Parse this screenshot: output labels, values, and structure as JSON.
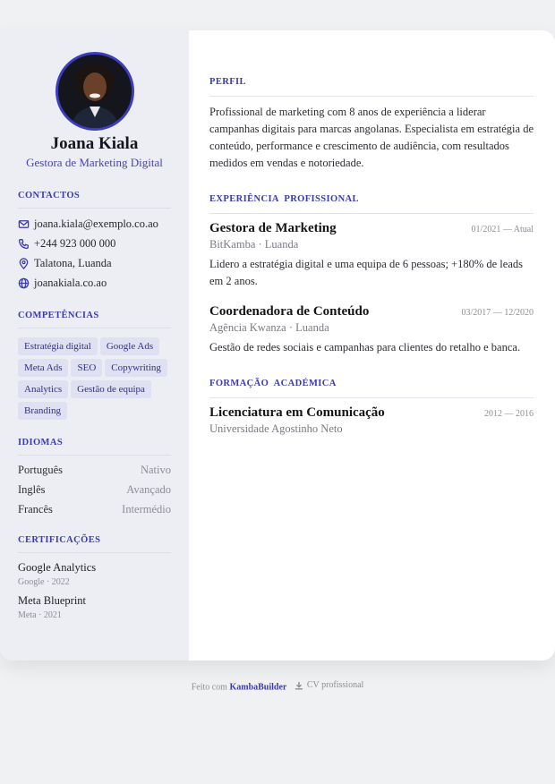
{
  "profile": {
    "name": "Joana Kiala",
    "role": "Gestora de Marketing Digital"
  },
  "contacts": {
    "title": "CONTACTOS",
    "email": "joana.kiala@exemplo.co.ao",
    "phone": "+244 923 000 000",
    "location": "Talatona, Luanda",
    "website": "joanakiala.co.ao"
  },
  "skills": {
    "title": "COMPETÊNCIAS",
    "items": [
      "Estratégia digital",
      "Google Ads",
      "Meta Ads",
      "SEO",
      "Copywriting",
      "Analytics",
      "Gestão de equipa",
      "Branding"
    ]
  },
  "languages": {
    "title": "IDIOMAS",
    "items": [
      {
        "name": "Português",
        "level": "Nativo"
      },
      {
        "name": "Inglês",
        "level": "Avançado"
      },
      {
        "name": "Francês",
        "level": "Intermédio"
      }
    ]
  },
  "certifications": {
    "title": "CERTIFICAÇÕES",
    "items": [
      {
        "name": "Google Analytics",
        "meta": "Google · 2022"
      },
      {
        "name": "Meta Blueprint",
        "meta": "Meta · 2021"
      }
    ]
  },
  "perfil": {
    "title": "PERFIL",
    "text": "Profissional de marketing com 8 anos de experiência a liderar campanhas digitais para marcas angolanas. Especialista em estratégia de conteúdo, performance e crescimento de audiência, com resultados medidos em vendas e notoriedade."
  },
  "experience": {
    "title": "EXPERIÊNCIA  PROFISSIONAL",
    "items": [
      {
        "title": "Gestora de Marketing",
        "date": "01/2021 — Atual",
        "company": "BitKamba · Luanda",
        "desc": "Lidero a estratégia digital e uma equipa de 6 pessoas; +180% de leads em 2 anos."
      },
      {
        "title": "Coordenadora de Conteúdo",
        "date": "03/2017 — 12/2020",
        "company": "Agência Kwanza · Luanda",
        "desc": "Gestão de redes sociais e campanhas para clientes do retalho e banca."
      }
    ]
  },
  "education": {
    "title": "FORMAÇÃO  ACADÉMICA",
    "items": [
      {
        "title": "Licenciatura em Comunicação",
        "date": "2012 — 2016",
        "school": "Universidade Agostinho Neto"
      }
    ]
  },
  "footer": {
    "made_with": "Feito com",
    "brand": "KambaBuilder",
    "download": "CV profissional"
  },
  "colors": {
    "accent": "#3a3bb0",
    "sidebar_bg": "#eceef4",
    "tag_bg": "#dfe0f1"
  },
  "icons": [
    "mail-icon",
    "phone-icon",
    "location-pin-icon",
    "globe-icon",
    "download-icon"
  ]
}
